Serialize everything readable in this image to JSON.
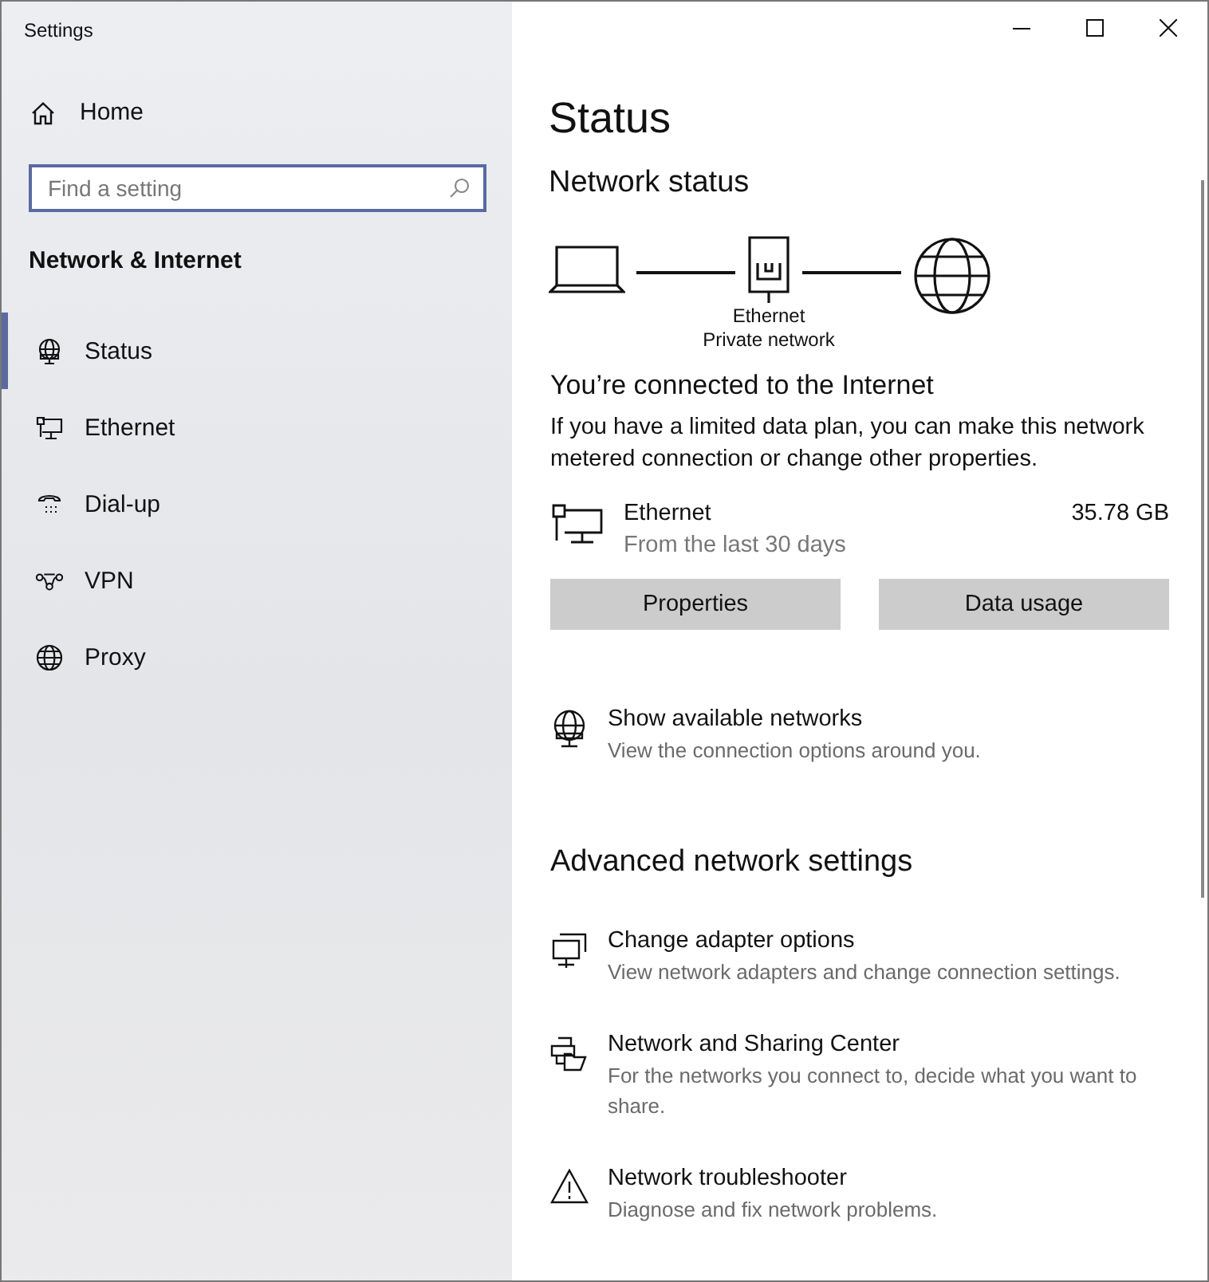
{
  "window": {
    "title": "Settings"
  },
  "sidebar": {
    "home": "Home",
    "search": {
      "placeholder": "Find a setting"
    },
    "section": "Network & Internet",
    "items": [
      {
        "label": "Status",
        "selected": true
      },
      {
        "label": "Ethernet",
        "selected": false
      },
      {
        "label": "Dial-up",
        "selected": false
      },
      {
        "label": "VPN",
        "selected": false
      },
      {
        "label": "Proxy",
        "selected": false
      }
    ]
  },
  "main": {
    "title": "Status",
    "subtitle": "Network status",
    "diagram": {
      "adapter": "Ethernet",
      "network": "Private network"
    },
    "connected": {
      "heading": "You’re connected to the Internet",
      "text": "If you have a limited data plan, you can make this network metered connection or change other properties."
    },
    "usage": {
      "name": "Ethernet",
      "period": "From the last 30 days",
      "amount": "35.78 GB"
    },
    "buttons": [
      "Properties",
      "Data usage"
    ],
    "show_networks": {
      "title": "Show available networks",
      "description": "View the connection options around you."
    },
    "advanced": {
      "heading": "Advanced network settings",
      "links": [
        {
          "title": "Change adapter options",
          "description": "View network adapters and change connection settings."
        },
        {
          "title": "Network and Sharing Center",
          "description": "For the networks you connect to, decide what you want to share."
        },
        {
          "title": "Network troubleshooter",
          "description": "Diagnose and fix network problems."
        }
      ]
    }
  }
}
